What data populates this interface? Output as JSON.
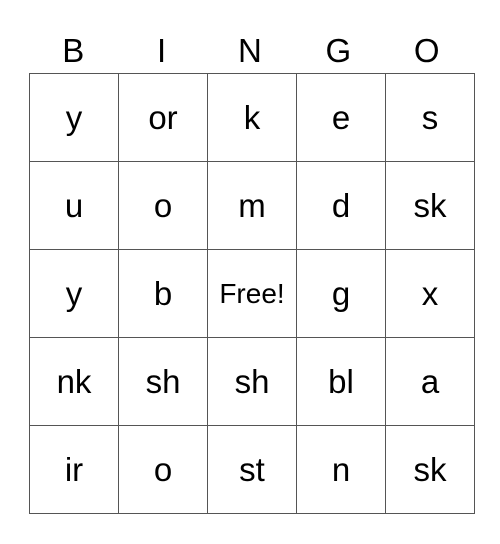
{
  "header": [
    "B",
    "I",
    "N",
    "G",
    "O"
  ],
  "rows": [
    [
      "y",
      "or",
      "k",
      "e",
      "s"
    ],
    [
      "u",
      "o",
      "m",
      "d",
      "sk"
    ],
    [
      "y",
      "b",
      "Free!",
      "g",
      "x"
    ],
    [
      "nk",
      "sh",
      "sh",
      "bl",
      "a"
    ],
    [
      "ir",
      "o",
      "st",
      "n",
      "sk"
    ]
  ]
}
